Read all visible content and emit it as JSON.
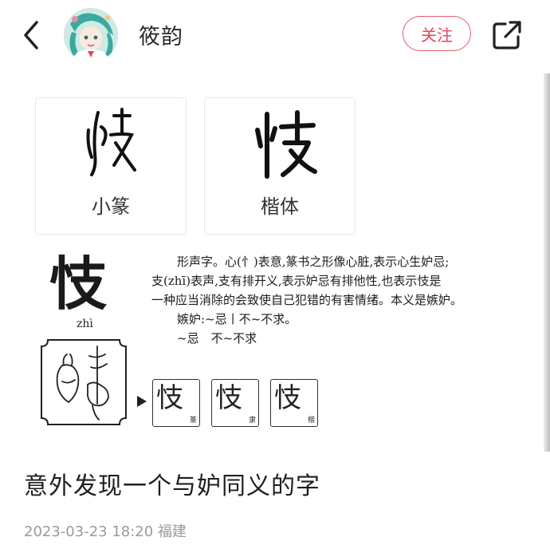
{
  "header": {
    "author_name": "筱韵",
    "follow_label": "关注",
    "icons": {
      "back": "chevron-left-icon",
      "share": "share-external-icon"
    }
  },
  "image": {
    "cards": [
      {
        "glyph": "忮",
        "label": "小篆"
      },
      {
        "glyph": "忮",
        "label": "楷体"
      }
    ],
    "big_char": "忮",
    "pinyin": "zhì",
    "explanation": {
      "line1": "形声字。心(忄)表意,篆书之形像心脏,表示心生妒忌;",
      "line2": "支(zhī)表声,支有排开义,表示妒忌有排他性,也表示忮是",
      "line3": "一种应当消除的会致使自己犯错的有害情绪。本义是嫉妒。",
      "line4": "嫉妒:~忌丨不~不求。",
      "line5": "~忌　不~不求"
    },
    "evolution": [
      {
        "char": "忮",
        "tag": "篆"
      },
      {
        "char": "忮",
        "tag": "隶"
      },
      {
        "char": "忮",
        "tag": "楷"
      }
    ]
  },
  "post": {
    "title": "意外发现一个与妒同义的字",
    "meta": "2023-03-23 18:20 福建"
  },
  "colors": {
    "accent": "#e2465c",
    "text_primary": "#1f1f1f",
    "text_secondary": "#9a9a9a"
  }
}
